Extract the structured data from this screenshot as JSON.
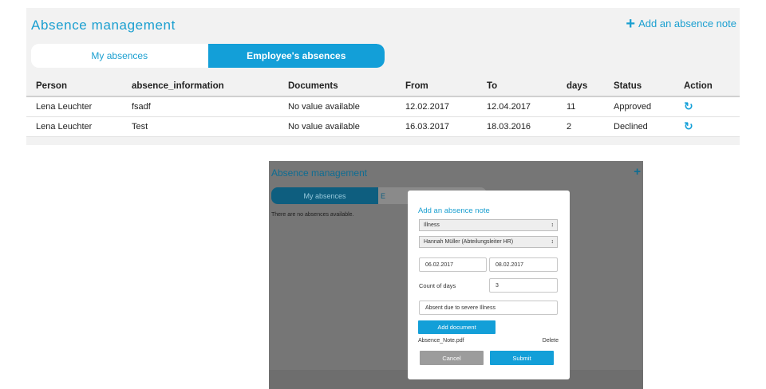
{
  "header": {
    "title": "Absence management",
    "add_label": "Add an absence note",
    "add_icon": "plus-icon"
  },
  "tabs": [
    {
      "label": "My absences",
      "active": false
    },
    {
      "label": "Employee's absences",
      "active": true
    }
  ],
  "table": {
    "columns": [
      "Person",
      "absence_information",
      "Documents",
      "From",
      "To",
      "days",
      "Status",
      "Action"
    ],
    "rows": [
      {
        "person": "Lena Leuchter",
        "info": "fsadf",
        "documents": "No value available",
        "from": "12.02.2017",
        "to": "12.04.2017",
        "days": "11",
        "status": "Approved",
        "action_icon": "refresh-icon"
      },
      {
        "person": "Lena Leuchter",
        "info": "Test",
        "documents": "No value available",
        "from": "16.03.2017",
        "to": "18.03.2016",
        "days": "2",
        "status": "Declined",
        "action_icon": "refresh-icon"
      }
    ]
  },
  "mobile": {
    "title": "Absence management",
    "tab_active": "My absences",
    "tab_inactive": "E",
    "empty_text": "There are no absences available."
  },
  "modal": {
    "title": "Add an absence note",
    "type_select": "Illness",
    "approver_select": "Hannah Müller (Abteilungsleiter HR)",
    "from_date": "06.02.2017",
    "to_date": "08.02.2017",
    "count_label": "Count of days",
    "count_value": "3",
    "reason": "Absent due to severe Illness",
    "add_document": "Add document",
    "file_name": "Absence_Note.pdf",
    "delete_label": "Delete",
    "cancel_label": "Cancel",
    "submit_label": "Submit"
  },
  "colors": {
    "accent": "#139fd8",
    "title": "#1a9fd0",
    "overlay": "#767676"
  }
}
